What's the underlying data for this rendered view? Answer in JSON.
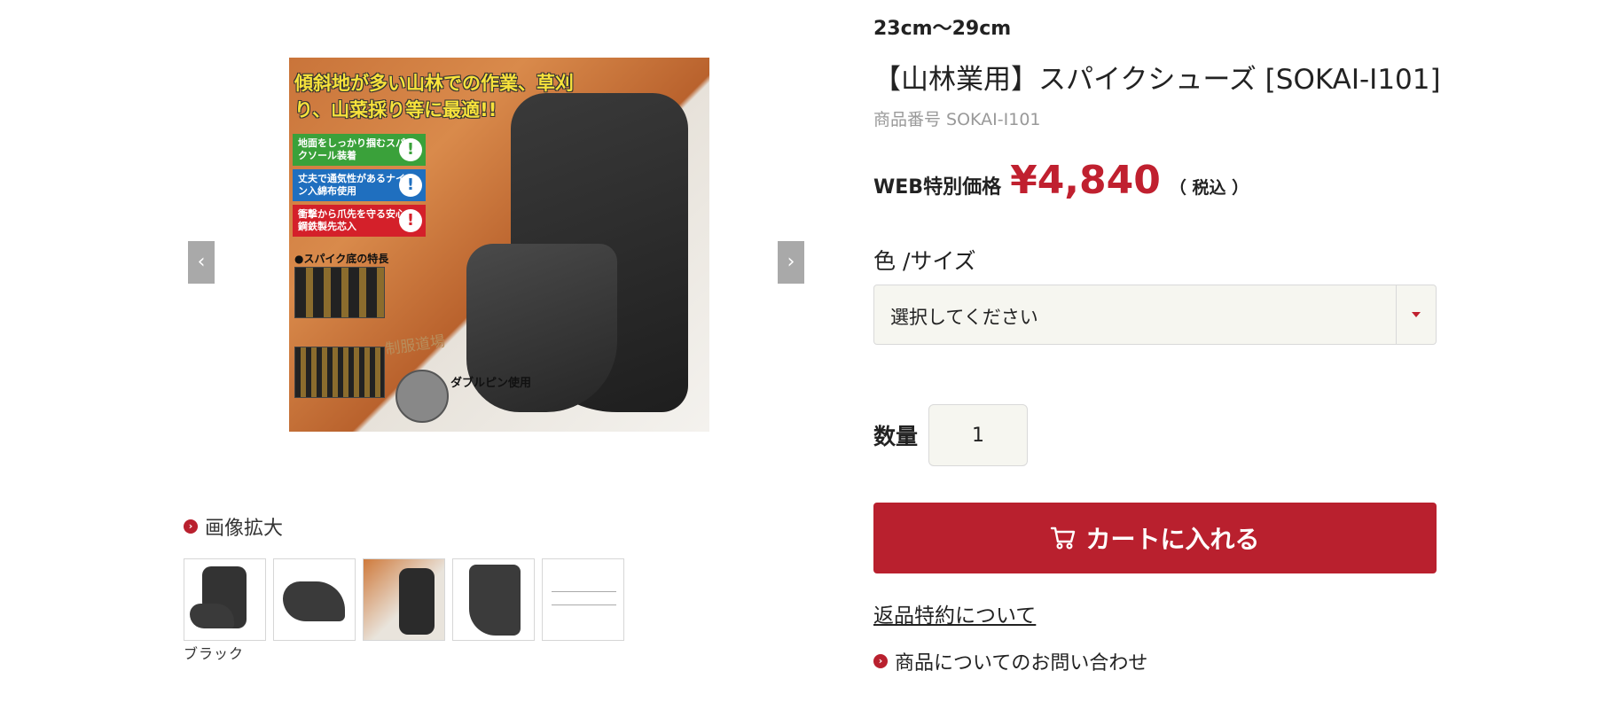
{
  "gallery": {
    "headline": "傾斜地が多い山林での作業、草刈り、山菜採り等に最適!!",
    "features": [
      {
        "text": "地面をしっかり掴むスパイクソール装着",
        "color": "#3aa13a"
      },
      {
        "text": "丈夫で通気性があるナイロン入綿布使用",
        "color": "#1f6fbf"
      },
      {
        "text": "衝撃から爪先を守る安心の鋼鉄製先芯入",
        "color": "#d4202a"
      }
    ],
    "spike_section_title": "●スパイク底の特長",
    "double_pin_title": "ダブルピン使用",
    "watermark": "制服道場",
    "prev_arrow": "‹",
    "next_arrow": "›",
    "zoom_label": "画像拡大",
    "thumbnail_caption": "ブラック",
    "thumbnails": [
      "boot-side",
      "toe-cap",
      "feature-sheet",
      "boot-front",
      "size-chart"
    ]
  },
  "product": {
    "size_range": "23cm〜29cm",
    "title": "【山林業用】スパイクシューズ [SOKAI-I101]",
    "sku": "商品番号 SOKAI-I101",
    "price_label": "WEB特別価格",
    "price": "¥4,840",
    "tax": "（ 税込 ）",
    "variant_label": "色 /サイズ",
    "variant_select_value": "選択してください",
    "quantity_label": "数量",
    "quantity": "1",
    "cart_button": "カートに入れる",
    "returns_link": "返品特約について",
    "inquiry_link": "商品についてのお問い合わせ"
  },
  "colors": {
    "accent": "#b9202e",
    "price": "#c0202f",
    "input_bg": "#f6f6f0"
  }
}
